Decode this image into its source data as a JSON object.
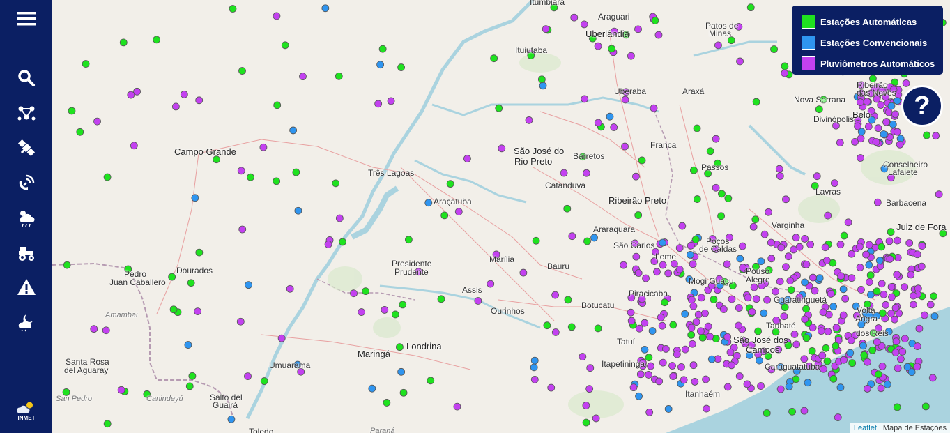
{
  "sidebar": {
    "items": [
      {
        "name": "menu-icon"
      },
      {
        "name": "search-icon"
      },
      {
        "name": "network-icon"
      },
      {
        "name": "satellite-icon"
      },
      {
        "name": "radar-icon"
      },
      {
        "name": "weather-rain-icon"
      },
      {
        "name": "tractor-icon"
      },
      {
        "name": "warning-icon"
      },
      {
        "name": "night-cloud-icon"
      }
    ],
    "logo_text": "INMET"
  },
  "legend": {
    "items": [
      {
        "label": "Estações Automáticas",
        "color": "#1fe21f"
      },
      {
        "label": "Estações Convencionais",
        "color": "#2f95f0"
      },
      {
        "label": "Pluviômetros Automáticos",
        "color": "#c341f0"
      }
    ]
  },
  "help_label": "?",
  "attribution": {
    "link": "Leaflet",
    "text": "| Mapa de Estações"
  },
  "places": [
    {
      "name": "Itumbiara"
    },
    {
      "name": "Araguari"
    },
    {
      "name": "Uberlândia"
    },
    {
      "name": "Patos de"
    },
    {
      "name": "Minas"
    },
    {
      "name": "Ituiutaba"
    },
    {
      "name": "Uberaba"
    },
    {
      "name": "Araxá"
    },
    {
      "name": "Nova Serrana"
    },
    {
      "name": "Ribeirão"
    },
    {
      "name": "das Neves"
    },
    {
      "name": "Divinópolis"
    },
    {
      "name": "Belo"
    },
    {
      "name": "Campo Grande"
    },
    {
      "name": "São José do"
    },
    {
      "name": "Rio Preto"
    },
    {
      "name": "Barretos"
    },
    {
      "name": "Franca"
    },
    {
      "name": "Passos"
    },
    {
      "name": "Conselheiro"
    },
    {
      "name": "Lafaiete"
    },
    {
      "name": "Três Lagoas"
    },
    {
      "name": "Catanduva"
    },
    {
      "name": "Lavras"
    },
    {
      "name": "Barbacena"
    },
    {
      "name": "Araçatuba"
    },
    {
      "name": "Ribeirão Preto"
    },
    {
      "name": "Varginha"
    },
    {
      "name": "Juiz de Fora"
    },
    {
      "name": "Araraquara"
    },
    {
      "name": "São Carlos"
    },
    {
      "name": "Poços"
    },
    {
      "name": "de Caldas"
    },
    {
      "name": "Leme"
    },
    {
      "name": "Marília"
    },
    {
      "name": "Bauru"
    },
    {
      "name": "Presidente"
    },
    {
      "name": "Prudente"
    },
    {
      "name": "Pedro"
    },
    {
      "name": "Juan Caballero"
    },
    {
      "name": "Dourados"
    },
    {
      "name": "Pouso"
    },
    {
      "name": "Alegre"
    },
    {
      "name": "Assis"
    },
    {
      "name": "Botucatu"
    },
    {
      "name": "Piracicaba"
    },
    {
      "name": "Mogi Guaçu"
    },
    {
      "name": "Guaratinguetá"
    },
    {
      "name": "Ourinhos"
    },
    {
      "name": "Amambai"
    },
    {
      "name": "Taubaté"
    },
    {
      "name": "Volta"
    },
    {
      "name": "Angra"
    },
    {
      "name": "dos Reis"
    },
    {
      "name": "Tatuí"
    },
    {
      "name": "São José dos"
    },
    {
      "name": "Campos"
    },
    {
      "name": "Londrina"
    },
    {
      "name": "Maringá"
    },
    {
      "name": "Santa Rosa"
    },
    {
      "name": "del Aguaray"
    },
    {
      "name": "Umuarama"
    },
    {
      "name": "Itapetininga"
    },
    {
      "name": "Caraguatatuba"
    },
    {
      "name": "San Pedro"
    },
    {
      "name": "Canindeyú"
    },
    {
      "name": "Salto del"
    },
    {
      "name": "Guairá"
    },
    {
      "name": "Itanhaém"
    },
    {
      "name": "Toledo"
    },
    {
      "name": "Paraná"
    }
  ]
}
